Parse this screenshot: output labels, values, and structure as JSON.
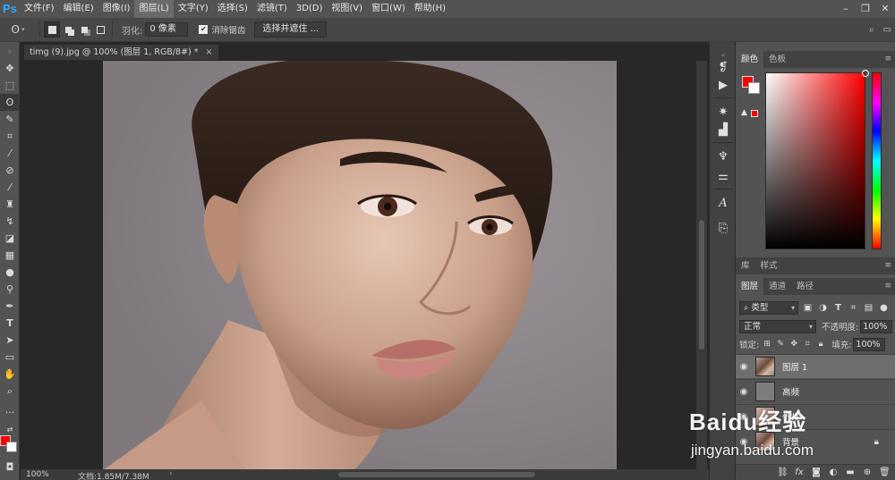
{
  "app": {
    "logo": "Ps"
  },
  "menu": [
    "文件(F)",
    "编辑(E)",
    "图像(I)",
    "图层(L)",
    "文字(Y)",
    "选择(S)",
    "滤镜(T)",
    "3D(D)",
    "视图(V)",
    "窗口(W)",
    "帮助(H)"
  ],
  "options": {
    "feather_label": "羽化:",
    "feather_value": "0 像素",
    "antialias_label": "消除锯齿",
    "antialias_checked": true,
    "select_mask_label": "选择并遮住 ..."
  },
  "document": {
    "tab_title": "timg (9).jpg @ 100% (图层 1, RGB/8#) *",
    "zoom": "100%",
    "doc_info": "文档:1.85M/7.38M"
  },
  "color_panel": {
    "tabs": [
      "颜色",
      "色板"
    ],
    "foreground_color": "#ff0000",
    "background_color": "#ffffff"
  },
  "library_panel": {
    "tabs": [
      "库",
      "样式"
    ]
  },
  "layers_panel": {
    "tabs": [
      "图层",
      "通道",
      "路径"
    ],
    "filter_kind": "类型",
    "blend_mode": "正常",
    "opacity_label": "不透明度:",
    "opacity_value": "100%",
    "lock_label": "锁定:",
    "fill_label": "填充:",
    "fill_value": "100%",
    "layers": [
      {
        "name": "图层 1",
        "visible": true,
        "selected": true
      },
      {
        "name": "高频",
        "visible": true,
        "selected": false
      },
      {
        "name": "低频",
        "visible": true,
        "selected": false
      },
      {
        "name": "背景",
        "visible": true,
        "selected": false,
        "locked": true
      }
    ]
  },
  "watermark": {
    "logo": "Baidu经验",
    "url": "jingyan.baidu.com"
  }
}
